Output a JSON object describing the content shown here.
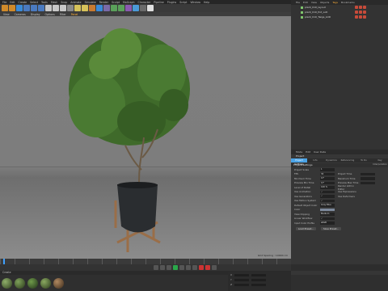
{
  "menubar": {
    "items": [
      "File",
      "Edit",
      "Create",
      "Select",
      "Tools",
      "Mesh",
      "Snap",
      "Animate",
      "Simulate",
      "Render",
      "Sculpt",
      "MoGraph",
      "Character",
      "Pipeline",
      "Plugins",
      "Script",
      "Window",
      "Help"
    ]
  },
  "viewport": {
    "menu": [
      "View",
      "Cameras",
      "Display",
      "Options",
      "Filter",
      "Panel"
    ],
    "status": "Grid Spacing : 10000 cm"
  },
  "objects": {
    "menu": [
      "File",
      "Edit",
      "View",
      "Objects",
      "Tags",
      "Bookmarks"
    ],
    "active_menu": "Tags",
    "items": [
      {
        "label": "plant_010_layout"
      },
      {
        "label": "plant_010_Pot_LoD"
      },
      {
        "label": "plant_010_Twigs_LOD"
      }
    ]
  },
  "attributes": {
    "menu": [
      "Mode",
      "Edit",
      "User Data"
    ],
    "title": "Project",
    "tabs": [
      "Project Settings",
      "Info",
      "Dynamics",
      "Referencing",
      "To Do",
      "Key Interpolation"
    ],
    "section": "Project Settings",
    "left_rows": [
      {
        "k": "Project Scale",
        "v": "1"
      },
      {
        "k": "FPS",
        "v": "30"
      },
      {
        "k": "Minimum Time",
        "v": "0 F"
      },
      {
        "k": "Preview Min Time",
        "v": "0 F"
      },
      {
        "k": "Level of Detail",
        "v": "100 %"
      },
      {
        "k": "Use Animation",
        "v": "✓"
      },
      {
        "k": "Use Generators",
        "v": "✓"
      },
      {
        "k": "Use Motion System",
        "v": "✓"
      },
      {
        "k": "Default Object Color",
        "v": "Gray Blue"
      },
      {
        "k": "Color",
        "v": ""
      },
      {
        "k": "View Clipping",
        "v": "Medium"
      },
      {
        "k": "Linear Workflow",
        "v": "✓"
      },
      {
        "k": "Input Color Profile",
        "v": "sRGB"
      }
    ],
    "right_rows": [
      "Project Time",
      "Maximum Time",
      "Preview Max Time",
      "Render LOD in Editor",
      "Use Expressions",
      "Use Deformers"
    ],
    "buttons": [
      "Load Preset...",
      "Save Preset..."
    ]
  },
  "materials": {
    "menu": [
      "Create",
      "Edit",
      "Function",
      "Texture"
    ],
    "count": 5
  },
  "coords": {
    "rows": [
      "X",
      "Y",
      "Z"
    ]
  }
}
